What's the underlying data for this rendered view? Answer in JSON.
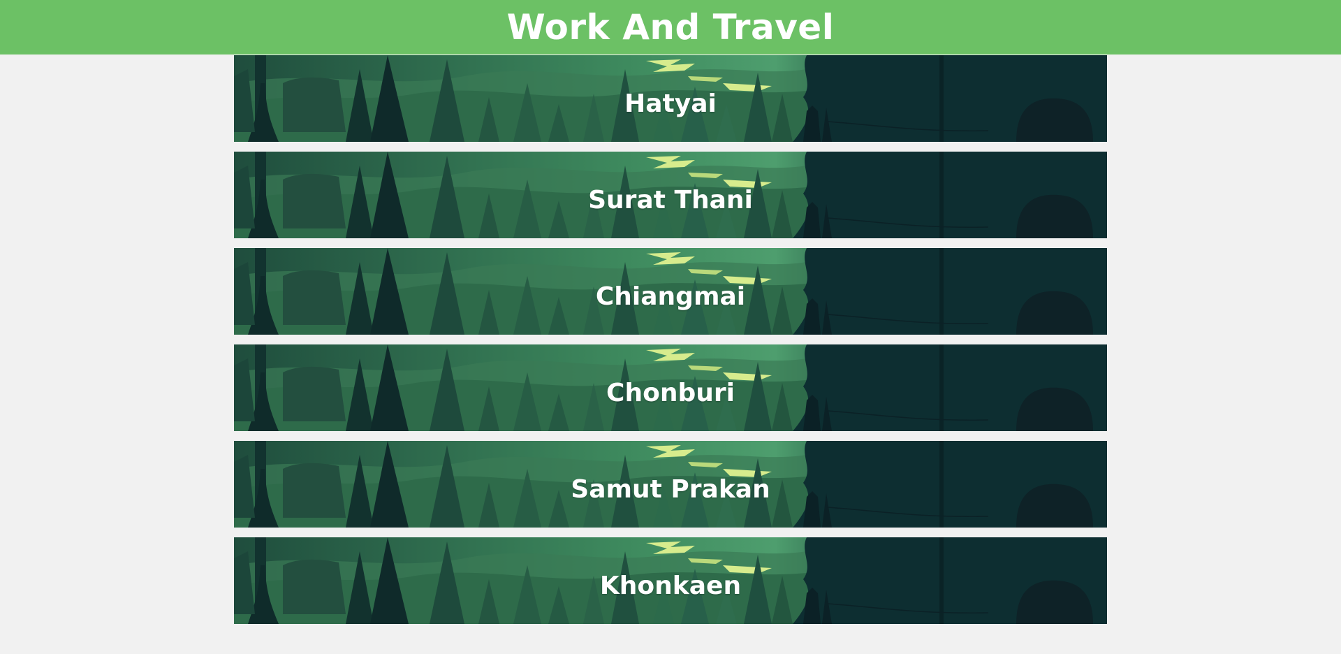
{
  "app": {
    "title": "Work And Travel",
    "accent_color": "#6cc165",
    "background_color": "#f1f1f1"
  },
  "cities": [
    {
      "name": "Hatyai"
    },
    {
      "name": "Surat Thani"
    },
    {
      "name": "Chiangmai"
    },
    {
      "name": "Chonburi"
    },
    {
      "name": "Samut Prakan"
    },
    {
      "name": "Khonkaen"
    }
  ],
  "card_background": "forest-landscape-illustration"
}
